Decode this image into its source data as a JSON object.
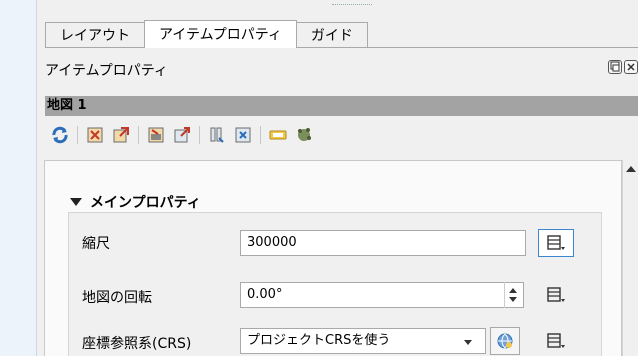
{
  "tabs": [
    {
      "label": "レイアウト"
    },
    {
      "label": "アイテムプロパティ"
    },
    {
      "label": "ガイド"
    }
  ],
  "dock": {
    "title": "アイテムプロパティ",
    "float_icon": "float-icon",
    "close_icon": "close-icon"
  },
  "item": {
    "name": "地図 1"
  },
  "toolbar": {
    "icons": [
      "refresh-icon",
      "set-extent-icon",
      "view-extent-icon",
      "set-scale-icon",
      "scale-icon",
      "bookmark-icon",
      "atlas-icon",
      "label-icon",
      "cluster-icon"
    ]
  },
  "section": {
    "title": "メインプロパティ"
  },
  "props": {
    "scale_label": "縮尺",
    "scale_value": "300000",
    "rotation_label": "地図の回転",
    "rotation_value": "0.00°",
    "crs_label": "座標参照系(CRS)",
    "crs_value": "プロジェクトCRSを使う"
  },
  "colors": {
    "tab_active": "#ffffff",
    "header_bar": "#a3a3a3",
    "focus_blue": "#3a86d0"
  }
}
